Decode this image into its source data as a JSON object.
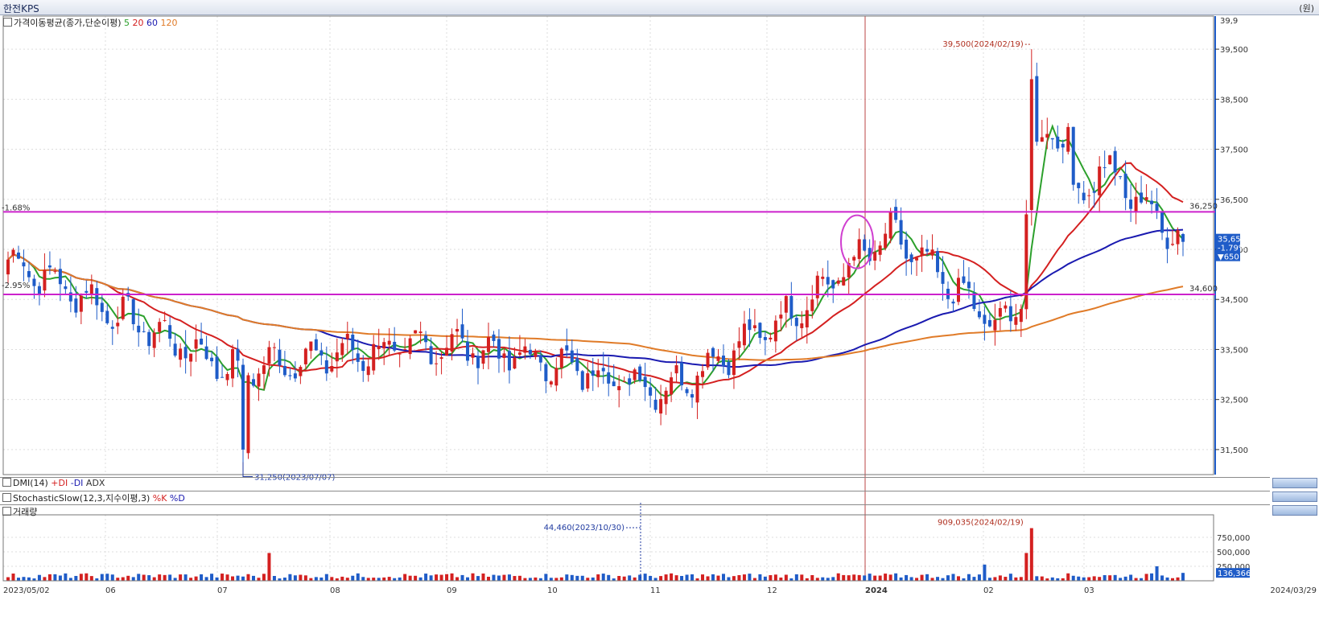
{
  "window": {
    "title": "한전KPS",
    "unit_label": "(원)"
  },
  "legend": {
    "label": "가격이동평균(종가,단순이평)",
    "periods": [
      "5",
      "20",
      "60",
      "120"
    ],
    "period_colors": [
      "#2ca02c",
      "#d42020",
      "#1a1ab0",
      "#e07b28"
    ]
  },
  "indicators": {
    "dmi": {
      "label": "DMI(14)",
      "plus_di": "+DI",
      "minus_di": "-DI",
      "adx": "ADX"
    },
    "stoch": {
      "label": "StochasticSlow(12,3,지수이평,3)",
      "k": "%K",
      "d": "%D"
    },
    "volume": {
      "label": "거래량"
    }
  },
  "annotations": {
    "high": "39,500(2024/02/19)",
    "low": "31,250(2023/07/07)",
    "line_upper_pct": "-1.68%",
    "line_lower_pct": "-2.95%",
    "line_upper_value": "36,250",
    "line_lower_value": "34,600",
    "current_price": "35,650",
    "current_change_pct": "-1.79%",
    "current_change": "▼650",
    "vol_peak": "909,035(2024/02/19)",
    "vol_oct": "44,460(2023/10/30)",
    "vol_current": "136,366"
  },
  "chart_data": {
    "type": "candlestick",
    "period": {
      "start": "2023/05/02",
      "end": "2024/03/29"
    },
    "x_tick_labels": [
      "2023/05/02",
      "06",
      "07",
      "08",
      "09",
      "10",
      "11",
      "12",
      "2024",
      "02",
      "03",
      "2024/03/29"
    ],
    "y_axis": {
      "ylim": [
        31000,
        40000
      ],
      "ticks": [
        "31,500",
        "32,500",
        "33,500",
        "34,500",
        "35,500",
        "36,500",
        "37,500",
        "38,500",
        "39,500",
        "39,9"
      ]
    },
    "volume_axis": {
      "ylim": [
        0,
        1000000
      ],
      "ticks": [
        "250,000",
        "500,000",
        "750,000"
      ]
    },
    "colors": {
      "up": "#d42020",
      "down": "#1f5cc8",
      "ma5": "#2ca02c",
      "ma20": "#d42020",
      "ma60": "#1a1ab0",
      "ma120": "#e07b28",
      "hline": "#cc22cc"
    },
    "horizontal_lines": [
      36250,
      34600
    ],
    "monthly_closes": [
      {
        "month": "2023/05",
        "close": 34200
      },
      {
        "month": "2023/06",
        "close": 33100
      },
      {
        "month": "2023/07",
        "close": 33400
      },
      {
        "month": "2023/08",
        "close": 33600
      },
      {
        "month": "2023/09",
        "close": 33200
      },
      {
        "month": "2023/10",
        "close": 32700
      },
      {
        "month": "2023/11",
        "close": 34100
      },
      {
        "month": "2023/12",
        "close": 35800
      },
      {
        "month": "2024/01",
        "close": 33900
      },
      {
        "month": "2024/02",
        "close": 37200
      },
      {
        "month": "2024/03",
        "close": 35650
      }
    ],
    "high": {
      "value": 39500,
      "date": "2024/02/19"
    },
    "low": {
      "value": 31250,
      "date": "2023/07/07"
    },
    "last_close": 35650,
    "volume_peak": {
      "value": 909035,
      "date": "2024/02/19"
    },
    "volume_last": 136366
  }
}
